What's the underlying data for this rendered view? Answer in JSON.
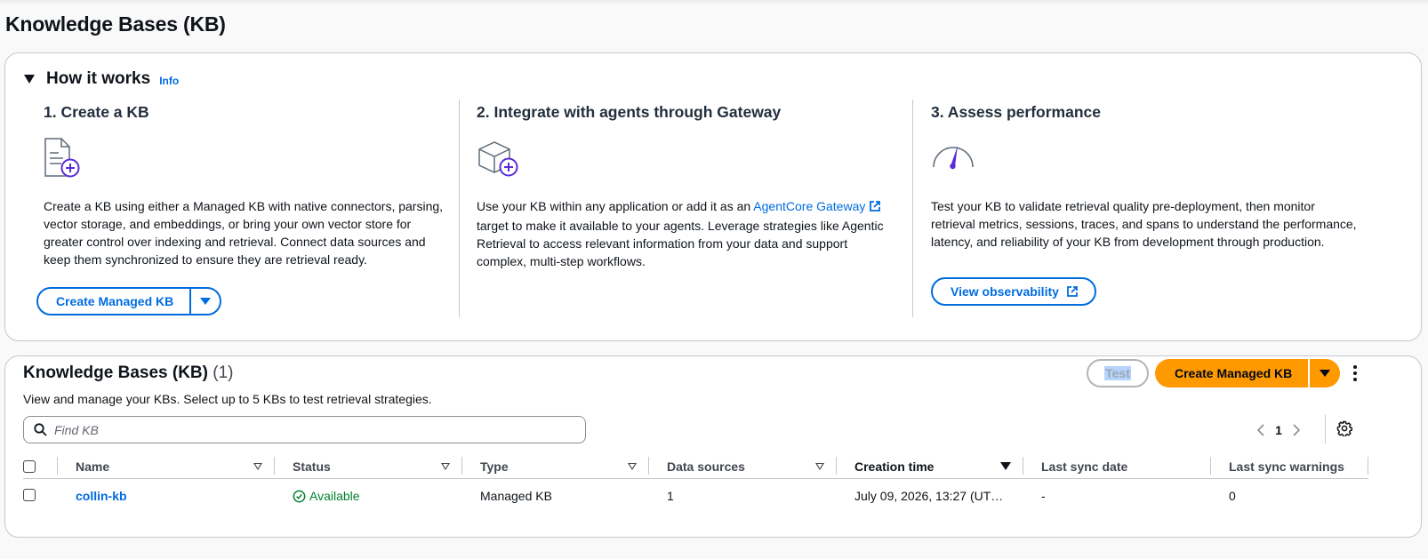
{
  "page": {
    "title": "Knowledge Bases (KB)"
  },
  "how_it_works": {
    "title": "How it works",
    "info_label": "Info",
    "steps": [
      {
        "title": "1. Create a KB",
        "icon": "document-add-icon",
        "description": "Create a KB using either a Managed KB with native connectors, parsing, vector storage, and embeddings, or bring your own vector store for greater control over indexing and retrieval. Connect data sources and keep them synchronized to ensure they are retrieval ready.",
        "button_label": "Create Managed KB"
      },
      {
        "title": "2. Integrate with agents through Gateway",
        "icon": "cube-add-icon",
        "description_before": "Use your KB within any application or add it as an ",
        "link_label": "AgentCore Gateway",
        "description_after": " target to make it available to your agents. Leverage strategies like Agentic Retrieval to access relevant information from your data and support complex, multi-step workflows."
      },
      {
        "title": "3. Assess performance",
        "icon": "gauge-icon",
        "description": "Test your KB to validate retrieval quality pre-deployment, then monitor retrieval metrics, sessions, traces, and spans to understand the performance, latency, and reliability of your KB from development through production.",
        "button_label": "View observability"
      }
    ]
  },
  "kb_list": {
    "title": "Knowledge Bases (KB)",
    "count": "(1)",
    "description": "View and manage your KBs. Select up to 5 KBs to test retrieval strategies.",
    "test_label": "Test",
    "create_label": "Create Managed KB",
    "search_placeholder": "Find KB",
    "page_number": "1",
    "columns": [
      "Name",
      "Status",
      "Type",
      "Data sources",
      "Creation time",
      "Last sync date",
      "Last sync warnings"
    ],
    "rows": [
      {
        "name": "collin-kb",
        "status": "Available",
        "type": "Managed KB",
        "data_sources": "1",
        "creation_time": "July 09, 2026, 13:27 (UT…",
        "last_sync_date": "-",
        "last_sync_warnings": "0"
      }
    ]
  },
  "colors": {
    "link": "#006ce0",
    "primary_button": "#ff9900",
    "success": "#00802f",
    "accent_icon": "#5b2bd8"
  }
}
